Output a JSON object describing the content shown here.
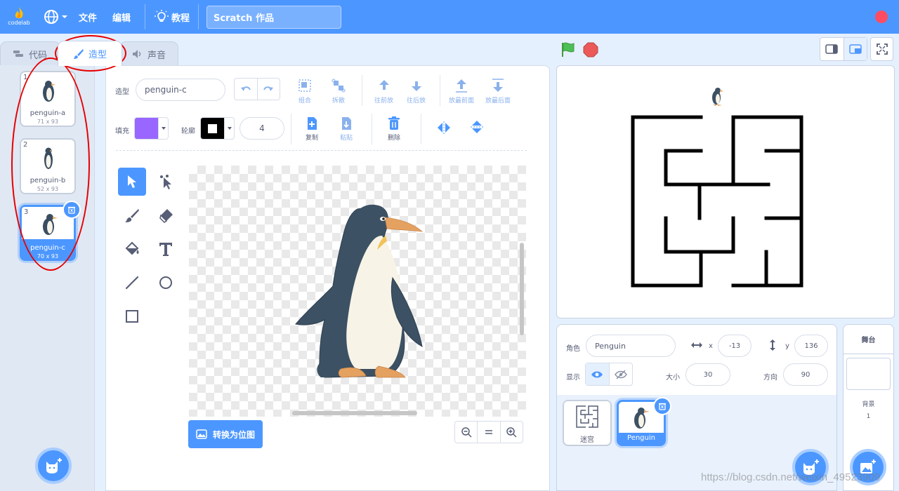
{
  "menubar": {
    "logo_text": "codelab",
    "file": "文件",
    "edit": "编辑",
    "tutorial": "教程",
    "project_title": "Scratch 作品"
  },
  "tabs": [
    {
      "label": "代码",
      "icon": "code-icon"
    },
    {
      "label": "造型",
      "icon": "brush-icon",
      "active": true
    },
    {
      "label": "声音",
      "icon": "speaker-icon"
    }
  ],
  "costumes": [
    {
      "num": "1",
      "name": "penguin-a",
      "size": "71 x 93"
    },
    {
      "num": "2",
      "name": "penguin-b",
      "size": "52 x 93"
    },
    {
      "num": "3",
      "name": "penguin-c",
      "size": "70 x 93",
      "selected": true
    }
  ],
  "editor": {
    "costume_label": "造型",
    "costume_name": "penguin-c",
    "fill_label": "填充",
    "fill_color": "#9966ff",
    "outline_label": "轮廓",
    "outline_width": "4",
    "group": "组合",
    "ungroup": "拆散",
    "forward": "往前放",
    "backward": "往后放",
    "front": "放最前面",
    "back": "放最后面",
    "copy": "复制",
    "paste": "粘贴",
    "delete": "删除",
    "convert": "转换为位图"
  },
  "sprite_info": {
    "sprite_label": "角色",
    "sprite_name": "Penguin",
    "x_label": "x",
    "x": "-13",
    "y_label": "y",
    "y": "136",
    "show_label": "显示",
    "size_label": "大小",
    "size": "30",
    "direction_label": "方向",
    "direction": "90"
  },
  "sprites": [
    {
      "name": "迷宫"
    },
    {
      "name": "Penguin",
      "selected": true
    }
  ],
  "stage_pane": {
    "title": "舞台",
    "backdrop_label": "背景",
    "backdrop_count": "1"
  },
  "colors": {
    "accent": "#4c97ff",
    "menubar": "#4c97ff",
    "rec": "#ff4c63",
    "flag": "#4cbf56",
    "stop": "#ec5959"
  },
  "watermark": "https://blog.csdn.net/weixin_49523909"
}
